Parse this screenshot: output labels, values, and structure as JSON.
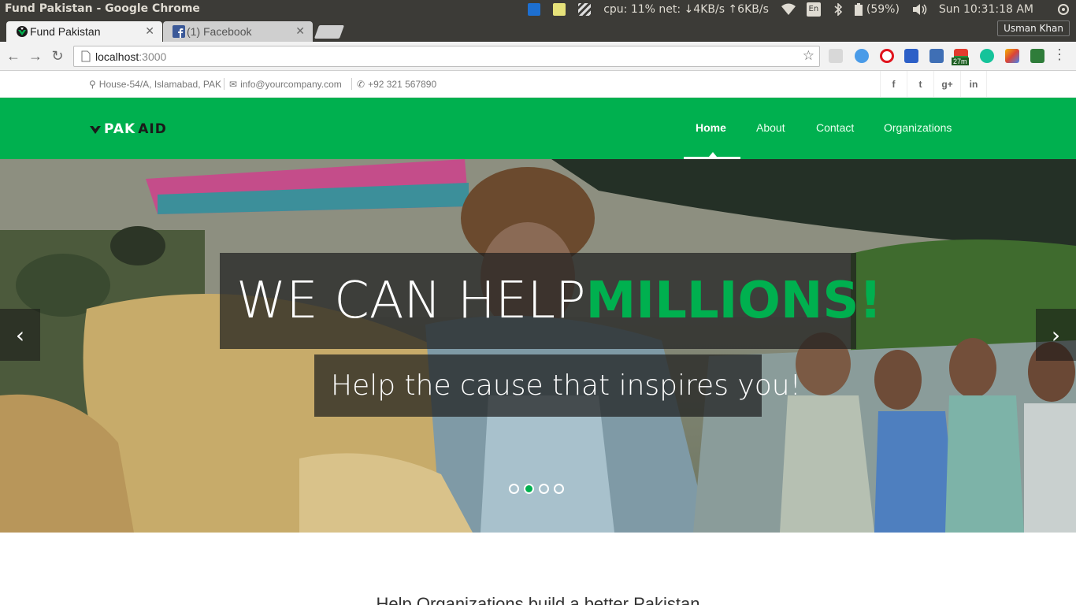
{
  "os": {
    "window_title": "Fund Pakistan - Google Chrome",
    "cpu_net": "cpu: 11% net: ↓4KB/s ↑6KB/s",
    "lang": "En",
    "battery": "(59%)",
    "clock": "Sun 10:31:18 AM"
  },
  "browser": {
    "tabs": [
      {
        "label": "Fund Pakistan",
        "active": true
      },
      {
        "label": "(1) Facebook",
        "active": false
      }
    ],
    "user": "Usman Khan",
    "url_host": "localhost",
    "url_port": ":3000",
    "ext_badge": "27m"
  },
  "topinfo": {
    "address": "House-54/A, Islamabad, PAK",
    "email": "info@yourcompany.com",
    "phone": "+92 321 567890",
    "social": [
      "f",
      "t",
      "g+",
      "in"
    ]
  },
  "nav": {
    "logo_left": "PAK",
    "logo_right": "AID",
    "items": [
      "Home",
      "About",
      "Contact",
      "Organizations"
    ],
    "active": "Home"
  },
  "hero": {
    "headline_main": "WE CAN HELP",
    "headline_accent": "MILLIONS!",
    "subline": "Help the cause that inspires you!",
    "slide_count": 4,
    "active_slide": 2
  },
  "section": {
    "title": "Help Organizations build a better Pakistan"
  },
  "colors": {
    "brand_green": "#00b04f",
    "os_bar": "#3c3b37"
  }
}
